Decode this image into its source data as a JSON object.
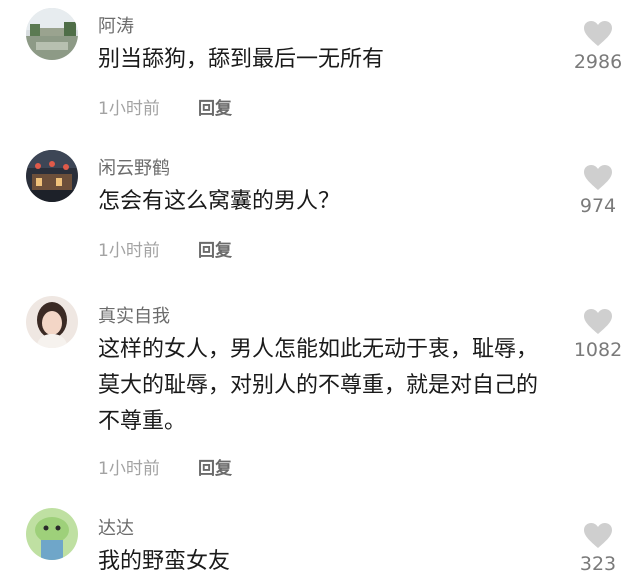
{
  "comments": [
    {
      "username": "阿涛",
      "text": "别当舔狗，舔到最后一无所有",
      "time": "1小时前",
      "reply_label": "回复",
      "likes": "2986",
      "avatar_icon": "landscape-photo-avatar"
    },
    {
      "username": "闲云野鹤",
      "text": "怎会有这么窝囊的男人？",
      "time": "1小时前",
      "reply_label": "回复",
      "likes": "974",
      "avatar_icon": "night-street-photo-avatar"
    },
    {
      "username": "真实自我",
      "text": "这样的女人，男人怎能如此无动于衷，耻辱，莫大的耻辱，对别人的不尊重，就是对自己的不尊重。",
      "time": "1小时前",
      "reply_label": "回复",
      "likes": "1082",
      "avatar_icon": "portrait-photo-avatar"
    },
    {
      "username": "达达",
      "text": "我的野蛮女友",
      "time": "",
      "reply_label": "",
      "likes": "323",
      "avatar_icon": "cartoon-character-avatar"
    }
  ],
  "icons": {
    "like": "heart-icon"
  },
  "colors": {
    "username": "#6b6b6b",
    "text": "#1a1a1a",
    "time": "#a3a3a3",
    "heart": "#cfcfcf",
    "like_count": "#7a7a7a"
  }
}
